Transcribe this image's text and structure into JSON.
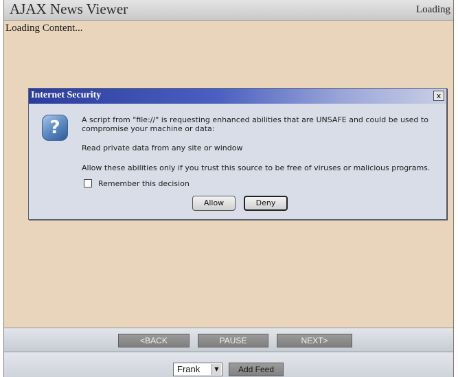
{
  "window": {
    "title": "AJAX News Viewer",
    "status": "Loading"
  },
  "content": {
    "text": "Loading Content..."
  },
  "dialog": {
    "title": "Internet Security",
    "close_label": "x",
    "icon": "question-icon",
    "message_line1": "A script from \"file://\" is requesting enhanced abilities that are UNSAFE and could be used to compromise your machine or data:",
    "permission": "Read private data from any site or window",
    "warning": "Allow these abilities only if you trust this source to be free of viruses or malicious programs.",
    "remember_label": "Remember this decision",
    "remember_checked": false,
    "allow_label": "Allow",
    "deny_label": "Deny"
  },
  "nav": {
    "back_label": "<BACK",
    "pause_label": "PAUSE",
    "next_label": "NEXT>"
  },
  "footer": {
    "feed_select_value": "Frank",
    "add_feed_label": "Add Feed"
  },
  "colors": {
    "content_bg": "#e8d5bb",
    "dialog_title_bg": "#2b3d9c",
    "nav_button_bg": "#8c8c8c"
  }
}
